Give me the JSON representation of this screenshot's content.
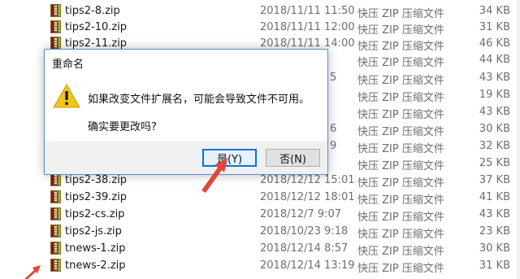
{
  "files": [
    {
      "name": "tips2-8.zip",
      "date": "2018/11/11 11:50",
      "type": "快压 ZIP 压缩文件",
      "size": "34 KB"
    },
    {
      "name": "tips2-10.zip",
      "date": "2018/11/11 12:00",
      "type": "快压 ZIP 压缩文件",
      "size": "31 KB"
    },
    {
      "name": "tips2-11.zip",
      "date": "2018/11/11 14:00",
      "type": "快压 ZIP 压缩文件",
      "size": "46 KB"
    },
    {
      "name": "",
      "date": "",
      "type": "快压 ZIP 压缩文件",
      "size": "44 KB"
    },
    {
      "name": "",
      "date": "5",
      "type": "快压 ZIP 压缩文件",
      "size": "43 KB"
    },
    {
      "name": "",
      "date": "",
      "type": "快压 ZIP 压缩文件",
      "size": "19 KB"
    },
    {
      "name": "",
      "date": "",
      "type": "快压 ZIP 压缩文件",
      "size": "43 KB"
    },
    {
      "name": "",
      "date": "6",
      "type": "快压 ZIP 压缩文件",
      "size": "30 KB"
    },
    {
      "name": "",
      "date": "9",
      "type": "快压 ZIP 压缩文件",
      "size": "32 KB"
    },
    {
      "name": "",
      "date": "",
      "type": "快压 ZIP 压缩文件",
      "size": "25 KB"
    },
    {
      "name": "tips2-38.zip",
      "date": "2018/12/12 15:01",
      "type": "快压 ZIP 压缩文件",
      "size": "37 KB"
    },
    {
      "name": "tips2-39.zip",
      "date": "2018/12/12 18:01",
      "type": "快压 ZIP 压缩文件",
      "size": "41 KB"
    },
    {
      "name": "tips2-cs.zip",
      "date": "2018/12/7 9:07",
      "type": "快压 ZIP 压缩文件",
      "size": "43 KB"
    },
    {
      "name": "tips2-js.zip",
      "date": "2018/10/23 9:18",
      "type": "快压 ZIP 压缩文件",
      "size": "23 KB"
    },
    {
      "name": "tnews-1.zip",
      "date": "2018/12/14 8:57",
      "type": "快压 ZIP 压缩文件",
      "size": "30 KB"
    },
    {
      "name": "tnews-2.zip",
      "date": "2018/12/14 13:19",
      "type": "快压 ZIP 压缩文件",
      "size": "31 KB"
    }
  ],
  "dialog": {
    "title": "重命名",
    "message": "如果改变文件扩展名，可能会导致文件不可用。",
    "confirm": "确实要更改吗?",
    "yes_label": "是(Y)",
    "no_label": "否(N)"
  },
  "colors": {
    "accent": "#0078d7",
    "dialog_border": "#5b8fc9",
    "arrow": "#e2453a",
    "warning": "#f5c518"
  }
}
